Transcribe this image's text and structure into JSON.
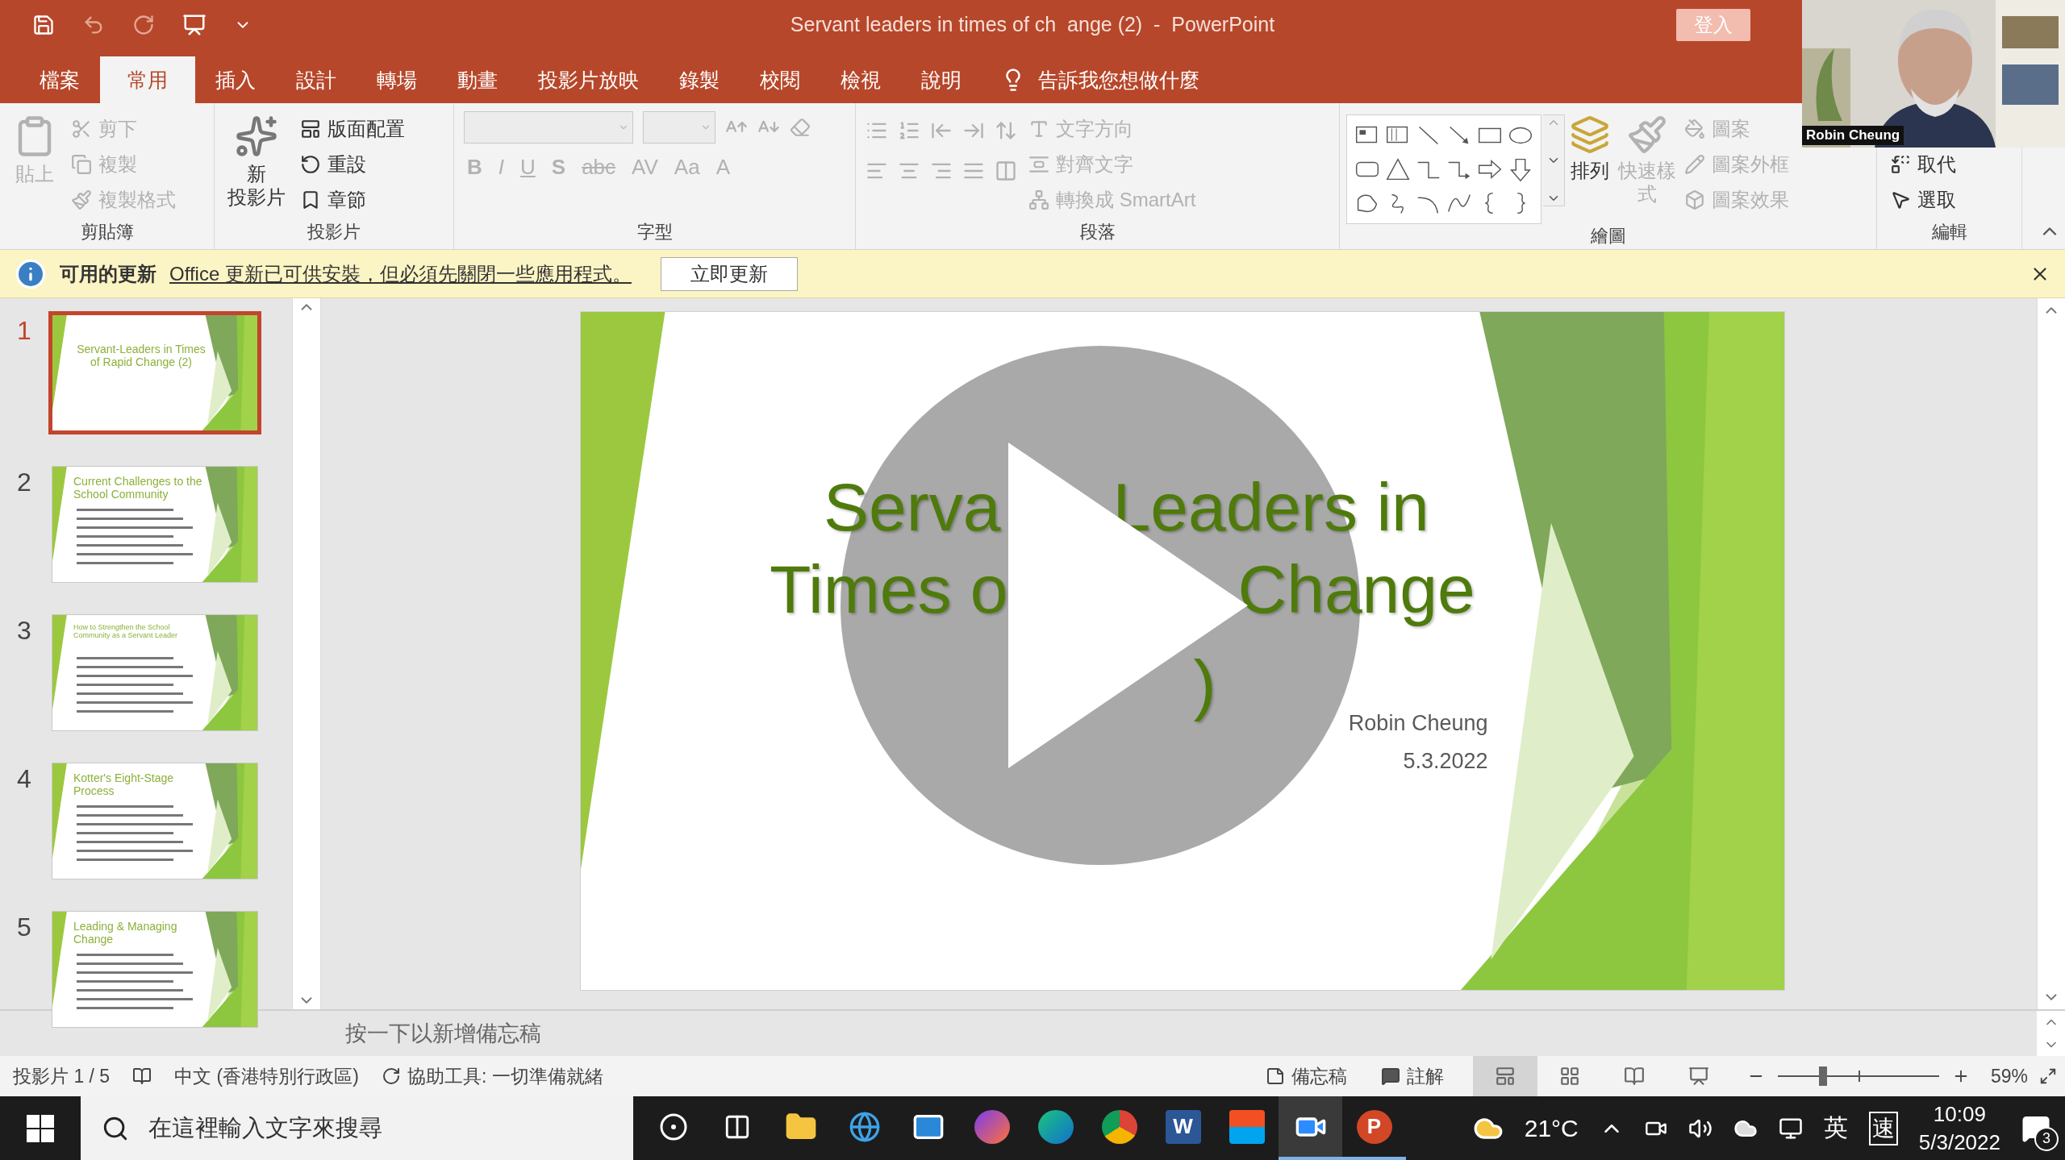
{
  "title_bar": {
    "title": "Servant leaders in times of ch  ange (2)  -  PowerPoint",
    "sign_in": "登入"
  },
  "tabs": [
    {
      "label": "檔案",
      "selected": false
    },
    {
      "label": "常用",
      "selected": true
    },
    {
      "label": "插入",
      "selected": false
    },
    {
      "label": "設計",
      "selected": false
    },
    {
      "label": "轉場",
      "selected": false
    },
    {
      "label": "動畫",
      "selected": false
    },
    {
      "label": "投影片放映",
      "selected": false
    },
    {
      "label": "錄製",
      "selected": false
    },
    {
      "label": "校閱",
      "selected": false
    },
    {
      "label": "檢視",
      "selected": false
    },
    {
      "label": "說明",
      "selected": false
    }
  ],
  "tell_me": "告訴我您想做什麼",
  "ribbon": {
    "clipboard": {
      "label": "剪貼簿",
      "paste": {
        "label": "貼上",
        "disabled": true
      },
      "small": [
        {
          "label": "剪下",
          "disabled": true
        },
        {
          "label": "複製",
          "disabled": true
        },
        {
          "label": "複製格式",
          "disabled": true
        }
      ]
    },
    "slides": {
      "label": "投影片",
      "new_slide": [
        "新",
        "投影片"
      ],
      "small": [
        {
          "label": "版面配置",
          "disabled": false
        },
        {
          "label": "重設",
          "disabled": false
        },
        {
          "label": "章節",
          "disabled": false
        }
      ]
    },
    "font": {
      "label": "字型",
      "disabled": true,
      "format_buttons": [
        "B",
        "I",
        "U",
        "S",
        "abc",
        "AV",
        "Aa",
        "A"
      ]
    },
    "paragraph": {
      "label": "段落",
      "small": [
        {
          "label": "文字方向",
          "disabled": true
        },
        {
          "label": "對齊文字",
          "disabled": true
        },
        {
          "label": "轉換成 SmartArt",
          "disabled": true
        }
      ]
    },
    "drawing": {
      "label": "繪圖",
      "arrange": "排列",
      "quick_styles": {
        "label": "快速樣式",
        "disabled": true
      },
      "small": [
        {
          "label": "圖案",
          "disabled": true
        },
        {
          "label": "圖案外框",
          "disabled": true
        },
        {
          "label": "圖案效果",
          "disabled": true
        }
      ]
    },
    "editing": {
      "label": "編輯",
      "small": [
        {
          "label": "取代",
          "disabled": false
        },
        {
          "label": "選取",
          "disabled": false
        }
      ]
    }
  },
  "info_bar": {
    "title": "可用的更新",
    "message": "Office 更新已可供安裝，但必須先關閉一些應用程式。",
    "button": "立即更新"
  },
  "slides": [
    {
      "number": "1",
      "selected": true,
      "title": "Servant-Leaders in Times of Rapid Change (2)",
      "bullets": false
    },
    {
      "number": "2",
      "selected": false,
      "title": "Current Challenges to the School Community",
      "bullets": true
    },
    {
      "number": "3",
      "selected": false,
      "title": "How to Strengthen the School Community as a Servant Leader",
      "bullets": true
    },
    {
      "number": "4",
      "selected": false,
      "title": "Kotter's Eight-Stage Process",
      "bullets": true
    },
    {
      "number": "5",
      "selected": false,
      "title": "Leading & Managing Change",
      "bullets": true
    }
  ],
  "current_slide": {
    "title_fragments": [
      "Serva",
      "Leaders in",
      "Times o",
      "Change",
      ")"
    ],
    "author": "Robin Cheung",
    "date": "5.3.2022"
  },
  "notes": {
    "placeholder": "按一下以新增備忘稿"
  },
  "status_bar": {
    "slide": "投影片 1 / 5",
    "language": "中文 (香港特別行政區)",
    "accessibility": "協助工具: 一切準備就緒",
    "notes": "備忘稿",
    "comments": "註解",
    "views": [
      {
        "kind": "normal",
        "selected": true
      },
      {
        "kind": "sorter",
        "selected": false
      },
      {
        "kind": "reading",
        "selected": false
      },
      {
        "kind": "show",
        "selected": false
      }
    ],
    "zoom": {
      "level": 0.28
    },
    "zoom_reading": "59%"
  },
  "video": {
    "name": "Robin Cheung"
  },
  "taskbar": {
    "search_placeholder": "在這裡輸入文字來搜尋",
    "apps": [
      {
        "kind": "cortana",
        "running": false,
        "selected": false
      },
      {
        "kind": "taskview",
        "running": false,
        "selected": false
      },
      {
        "kind": "files",
        "running": false,
        "selected": false
      },
      {
        "kind": "ie",
        "running": false,
        "selected": false
      },
      {
        "kind": "mail",
        "running": false,
        "selected": false
      },
      {
        "kind": "firefox",
        "running": false,
        "selected": false
      },
      {
        "kind": "edge",
        "running": false,
        "selected": false
      },
      {
        "kind": "chrome",
        "running": false,
        "selected": false
      },
      {
        "kind": "word",
        "letter": "W",
        "running": false,
        "selected": false
      },
      {
        "kind": "store",
        "running": false,
        "selected": false
      },
      {
        "kind": "zoom",
        "running": true,
        "selected": true
      },
      {
        "kind": "powerpoint",
        "letter": "P",
        "running": true,
        "selected": false
      }
    ],
    "temperature": "21°C",
    "ime": "英",
    "ime_mode": "速",
    "time": "10:09",
    "date": "5/3/2022",
    "notifications": "3"
  }
}
